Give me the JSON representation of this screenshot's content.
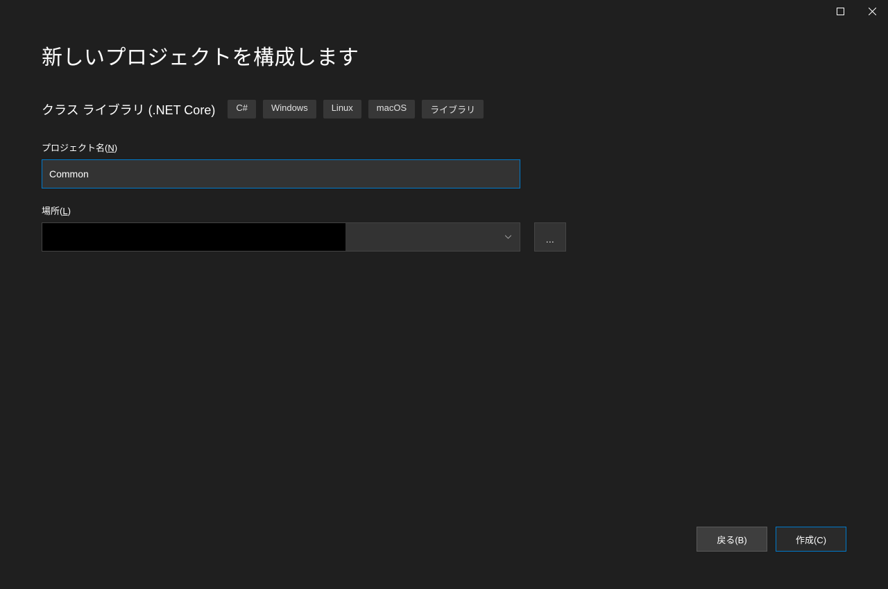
{
  "window": {
    "maximize_icon": "maximize",
    "close_icon": "close"
  },
  "header": {
    "title": "新しいプロジェクトを構成します",
    "template_name": "クラス ライブラリ (.NET Core)",
    "tags": [
      "C#",
      "Windows",
      "Linux",
      "macOS",
      "ライブラリ"
    ]
  },
  "form": {
    "project_name": {
      "label_prefix": "プロジェクト名(",
      "label_key": "N",
      "label_suffix": ")",
      "value": "Common"
    },
    "location": {
      "label_prefix": "場所(",
      "label_key": "L",
      "label_suffix": ")",
      "value": "",
      "browse_label": "..."
    }
  },
  "footer": {
    "back_prefix": "戻る(",
    "back_key": "B",
    "back_suffix": ")",
    "create_prefix": "作成(",
    "create_key": "C",
    "create_suffix": ")"
  }
}
